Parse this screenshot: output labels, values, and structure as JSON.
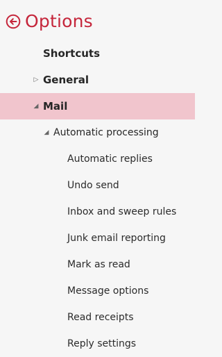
{
  "header": {
    "title": "Options",
    "back_icon": "circle-arrow-left-icon",
    "accent_color": "#c5263b"
  },
  "nav": {
    "shortcuts": "Shortcuts",
    "general": {
      "label": "General",
      "state": "collapsed"
    },
    "mail": {
      "label": "Mail",
      "state": "expanded",
      "selected": true,
      "selected_bg": "#f1c5cd"
    },
    "automatic_processing": {
      "label": "Automatic processing",
      "state": "expanded"
    },
    "items": [
      "Automatic replies",
      "Undo send",
      "Inbox and sweep rules",
      "Junk email reporting",
      "Mark as read",
      "Message options",
      "Read receipts",
      "Reply settings"
    ]
  }
}
